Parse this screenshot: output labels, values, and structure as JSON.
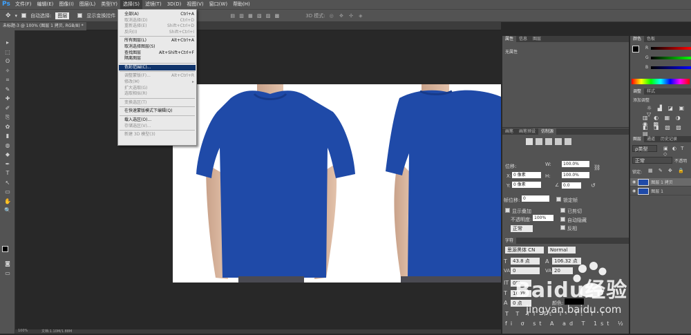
{
  "app": {
    "logo": "Ps"
  },
  "menubar": {
    "items": [
      "文件(F)",
      "编辑(E)",
      "图像(I)",
      "图层(L)",
      "类型(Y)",
      "选择(S)",
      "滤镜(T)",
      "3D(D)",
      "视图(V)",
      "窗口(W)",
      "帮助(H)"
    ],
    "active_index": 5
  },
  "options": {
    "auto_select_label": "自动选择:",
    "auto_select_value": "图层",
    "show_transform_label": "显示变换控件",
    "mode3d_label": "3D 模式:"
  },
  "document_tab": {
    "title": "未标题-3 @ 100% (图层 1 拷贝, RGB/8) *"
  },
  "select_menu": {
    "items": [
      {
        "label": "全部(A)",
        "shortcut": "Ctrl+A",
        "disabled": false
      },
      {
        "label": "取消选择(D)",
        "shortcut": "Ctrl+D",
        "disabled": true
      },
      {
        "label": "重新选择(E)",
        "shortcut": "Shift+Ctrl+D",
        "disabled": true
      },
      {
        "label": "反向(I)",
        "shortcut": "Shift+Ctrl+I",
        "disabled": true
      },
      {
        "label": "所有图层(L)",
        "shortcut": "Alt+Ctrl+A",
        "disabled": false
      },
      {
        "label": "取消选择图层(S)",
        "shortcut": "",
        "disabled": false
      },
      {
        "label": "查找图层",
        "shortcut": "Alt+Shift+Ctrl+F",
        "disabled": false
      },
      {
        "label": "隔离图层",
        "shortcut": "",
        "disabled": false
      },
      {
        "label": "色彩范围(C)...",
        "shortcut": "",
        "disabled": false,
        "highlight": true
      },
      {
        "label": "调整蒙版(F)...",
        "shortcut": "Alt+Ctrl+R",
        "disabled": true
      },
      {
        "label": "修改(M)",
        "shortcut": "▸",
        "disabled": true
      },
      {
        "label": "扩大选取(G)",
        "shortcut": "",
        "disabled": true
      },
      {
        "label": "选取相似(R)",
        "shortcut": "",
        "disabled": true
      },
      {
        "label": "变换选区(T)",
        "shortcut": "",
        "disabled": true
      },
      {
        "label": "在快速蒙版模式下编辑(Q)",
        "shortcut": "",
        "disabled": false
      },
      {
        "label": "载入选区(O)...",
        "shortcut": "",
        "disabled": false
      },
      {
        "label": "存储选区(V)...",
        "shortcut": "",
        "disabled": true
      },
      {
        "label": "新建 3D 模型(3)",
        "shortcut": "",
        "disabled": true
      }
    ]
  },
  "properties": {
    "tabs": [
      "属性",
      "信息",
      "图层"
    ],
    "no_props": "无属性"
  },
  "transform": {
    "tabs": [
      "画笔",
      "画笔预设",
      "仿制源"
    ],
    "offset_label": "位移:",
    "w_label": "W:",
    "w_value": "100.0%",
    "h_label": "H:",
    "h_value": "100.0%",
    "x_label": "X:",
    "x_value": "0 像素",
    "y_label": "Y:",
    "y_value": "0 像素",
    "angle_value": "0.0",
    "frame_offset_label": "帧位移:",
    "frame_offset_value": "0",
    "lock_frame": "锁定帧",
    "show_overlay": "显示叠加",
    "opacity_label": "不透明度:",
    "opacity_value": "100%",
    "blend_value": "正常",
    "clip": "已剪切",
    "auto_hide": "自动隐藏",
    "invert": "反相"
  },
  "character": {
    "tab": "字符",
    "font": "思源黑体 CN",
    "style": "Normal",
    "size": "43.8 点",
    "leading": "106.32 点",
    "kerning": "0",
    "tracking": "20",
    "vscale": "0%",
    "hscale": "100%",
    "baseline": "0 点",
    "color_label": "颜色:"
  },
  "color_panel": {
    "tabs": [
      "颜色",
      "色板"
    ],
    "channels": [
      "R",
      "G",
      "B"
    ]
  },
  "adjust_panel": {
    "tabs": [
      "调整",
      "样式"
    ],
    "add_label": "添加调整"
  },
  "layers_panel": {
    "tabs": [
      "图层",
      "通道",
      "历史记录"
    ],
    "kind": "ρ类型",
    "blend": "正常",
    "opacity_label": "不透明",
    "lock_label": "锁定:",
    "layers": [
      "图层 1 拷贝",
      "图层 1"
    ]
  },
  "status": {
    "zoom": "100%",
    "doc": "文档:1.10M/1.88M"
  },
  "watermark": {
    "brand": "Baidu经验",
    "url": "jingyan.baidu.com"
  }
}
